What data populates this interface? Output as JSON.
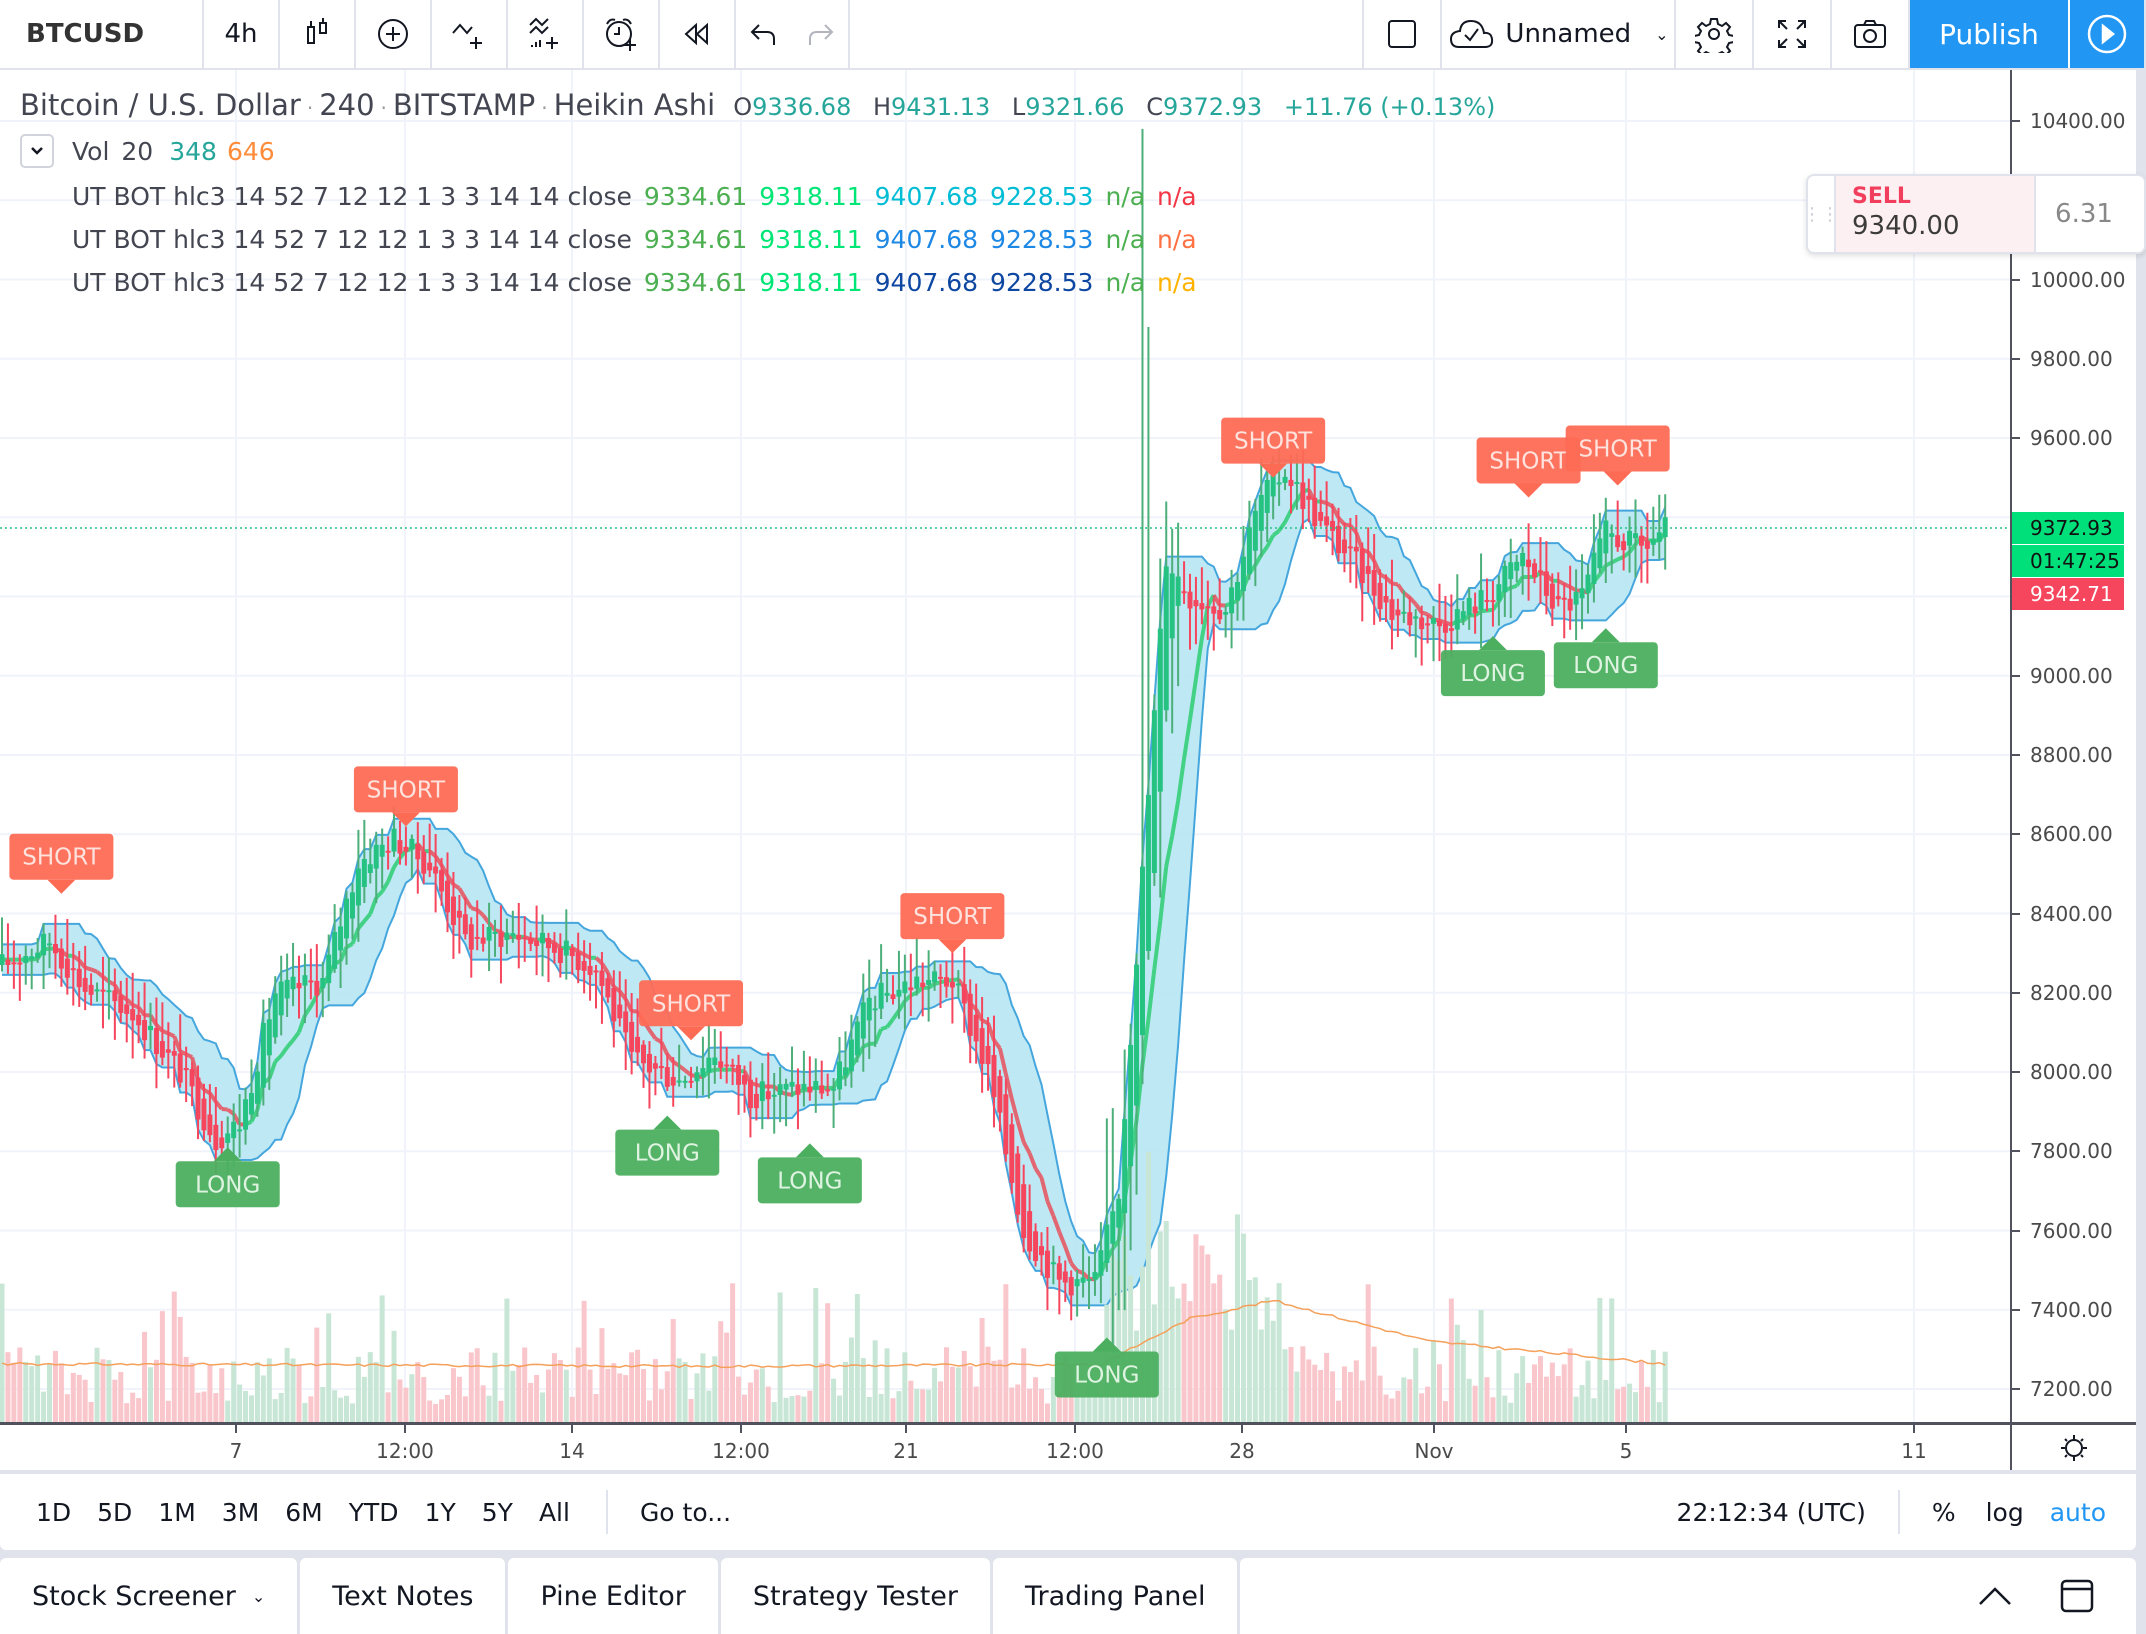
{
  "toolbar": {
    "symbol": "BTCUSD",
    "interval": "4h",
    "icons": [
      "candles-style-icon",
      "compare-add-icon",
      "indicators-icon",
      "financials-icon",
      "alert-add-icon",
      "replay-icon",
      "undo-icon",
      "redo-icon"
    ],
    "layout_name": "Unnamed",
    "publish_label": "Publish"
  },
  "legend": {
    "title": "Bitcoin / U.S. Dollar",
    "resolution": "240",
    "exchange": "BITSTAMP",
    "chart_type": "Heikin Ashi",
    "open_label": "O",
    "open": "9336.68",
    "high_label": "H",
    "high": "9431.13",
    "low_label": "L",
    "low": "9321.66",
    "close_label": "C",
    "close": "9372.93",
    "change": "+11.76 (+0.13%)",
    "volume": {
      "name": "Vol",
      "length": "20",
      "value": "348",
      "ma": "646"
    },
    "indicators": [
      {
        "name": "UT BOT hlc3 14 52 7 12 12 1 3 3 14 14 close",
        "values": [
          "9334.61",
          "9318.11",
          "9407.68",
          "9228.53",
          "n/a",
          "n/a"
        ],
        "colors": [
          "#4caf50",
          "#00e676",
          "#00bcd4",
          "#00bcd4",
          "#4caf50",
          "#f23645"
        ]
      },
      {
        "name": "UT BOT hlc3 14 52 7 12 12 1 3 3 14 14 close",
        "values": [
          "9334.61",
          "9318.11",
          "9407.68",
          "9228.53",
          "n/a",
          "n/a"
        ],
        "colors": [
          "#4caf50",
          "#00e676",
          "#1e88e5",
          "#1e88e5",
          "#4caf50",
          "#ff7043"
        ]
      },
      {
        "name": "UT BOT hlc3 14 52 7 12 12 1 3 3 14 14 close",
        "values": [
          "9334.61",
          "9318.11",
          "9407.68",
          "9228.53",
          "n/a",
          "n/a"
        ],
        "colors": [
          "#4caf50",
          "#00e676",
          "#0d47a1",
          "#0d47a1",
          "#4caf50",
          "#ffb300"
        ]
      }
    ]
  },
  "order_ticket": {
    "side": "SELL",
    "price": "9340.00",
    "spread": "6.31"
  },
  "price_axis": {
    "labels": [
      "10400.00",
      "10000.00",
      "9800.00",
      "9600.00",
      "9000.00",
      "8800.00",
      "8600.00",
      "8400.00",
      "8200.00",
      "8000.00",
      "7800.00",
      "7600.00",
      "7400.00",
      "7200.00"
    ],
    "last_price": "9372.93",
    "countdown": "01:47:25",
    "ha_price": "9342.71"
  },
  "time_axis": {
    "labels": [
      "7",
      "12:00",
      "14",
      "12:00",
      "21",
      "12:00",
      "28",
      "Nov",
      "5",
      "11"
    ]
  },
  "range_bar": {
    "ranges": [
      "1D",
      "5D",
      "1M",
      "3M",
      "6M",
      "YTD",
      "1Y",
      "5Y",
      "All"
    ],
    "goto": "Go to...",
    "clock": "22:12:34 (UTC)",
    "percent": "%",
    "log": "log",
    "auto": "auto"
  },
  "bottom_tabs": [
    "Stock Screener",
    "Text Notes",
    "Pine Editor",
    "Strategy Tester",
    "Trading Panel"
  ],
  "colors": {
    "up": "#26c281",
    "up_wick": "#4caf7a",
    "down": "#f6465d",
    "band": "#b3e5f2",
    "band_line": "#45a6dd",
    "short": "#fe6b55",
    "long": "#4caf60",
    "vol_up": "#c8e6d6",
    "vol_down": "#f9c6cb",
    "vol_ma": "#f5a05a",
    "accent": "#2196f3"
  },
  "chart_data": {
    "type": "candlestick",
    "title": "Bitcoin / U.S. Dollar · 240 · BITSTAMP · Heikin Ashi",
    "ylim": [
      7100,
      10550
    ],
    "x_ticks": [
      "7",
      "12:00",
      "14",
      "12:00",
      "21",
      "12:00",
      "28",
      "Nov",
      "5",
      "11"
    ],
    "price_path": [
      [
        0,
        8270
      ],
      [
        8,
        8330
      ],
      [
        14,
        8210
      ],
      [
        22,
        8150
      ],
      [
        30,
        8000
      ],
      [
        36,
        7830
      ],
      [
        40,
        7870
      ],
      [
        46,
        8200
      ],
      [
        54,
        8230
      ],
      [
        60,
        8530
      ],
      [
        66,
        8590
      ],
      [
        72,
        8520
      ],
      [
        78,
        8330
      ],
      [
        86,
        8350
      ],
      [
        94,
        8310
      ],
      [
        100,
        8260
      ],
      [
        106,
        8030
      ],
      [
        114,
        7980
      ],
      [
        120,
        8050
      ],
      [
        126,
        7940
      ],
      [
        134,
        7960
      ],
      [
        140,
        7960
      ],
      [
        146,
        8180
      ],
      [
        154,
        8230
      ],
      [
        160,
        8230
      ],
      [
        166,
        8000
      ],
      [
        172,
        7600
      ],
      [
        178,
        7470
      ],
      [
        184,
        7470
      ],
      [
        188,
        7700
      ],
      [
        192,
        8500
      ],
      [
        196,
        9300
      ],
      [
        200,
        9200
      ],
      [
        206,
        9170
      ],
      [
        212,
        9450
      ],
      [
        216,
        9520
      ],
      [
        222,
        9380
      ],
      [
        228,
        9280
      ],
      [
        234,
        9160
      ],
      [
        242,
        9130
      ],
      [
        250,
        9200
      ],
      [
        256,
        9300
      ],
      [
        262,
        9170
      ],
      [
        266,
        9200
      ],
      [
        270,
        9360
      ],
      [
        276,
        9320
      ],
      [
        280,
        9372
      ]
    ],
    "signals": [
      {
        "type": "SHORT",
        "index": 10,
        "price": 8450
      },
      {
        "type": "LONG",
        "index": 38,
        "price": 7810
      },
      {
        "type": "SHORT",
        "index": 68,
        "price": 8620
      },
      {
        "type": "SHORT",
        "index": 116,
        "price": 8080
      },
      {
        "type": "LONG",
        "index": 112,
        "price": 7890
      },
      {
        "type": "LONG",
        "index": 136,
        "price": 7820
      },
      {
        "type": "SHORT",
        "index": 160,
        "price": 8300
      },
      {
        "type": "LONG",
        "index": 186,
        "price": 7330
      },
      {
        "type": "SHORT",
        "index": 214,
        "price": 9500
      },
      {
        "type": "SHORT",
        "index": 257,
        "price": 9450
      },
      {
        "type": "LONG",
        "index": 251,
        "price": 9100
      },
      {
        "type": "SHORT",
        "index": 272,
        "price": 9480
      },
      {
        "type": "LONG",
        "index": 270,
        "price": 9120
      }
    ],
    "volume_ma_path": [
      [
        0,
        646
      ],
      [
        120,
        620
      ],
      [
        185,
        640
      ],
      [
        200,
        1150
      ],
      [
        214,
        1350
      ],
      [
        240,
        900
      ],
      [
        280,
        646
      ]
    ]
  }
}
